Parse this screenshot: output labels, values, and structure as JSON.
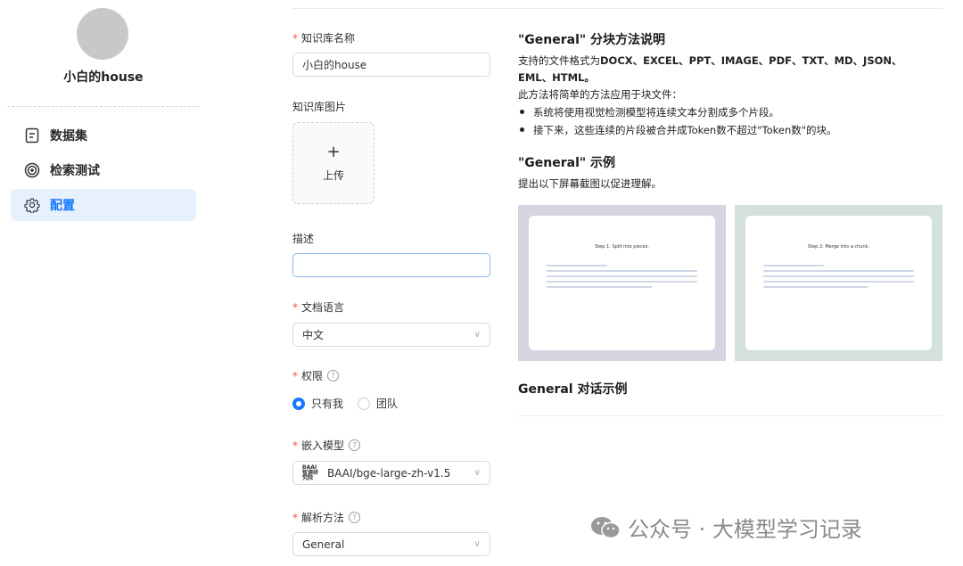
{
  "sidebar": {
    "kb_name": "小白的house",
    "items": [
      {
        "label": "数据集",
        "icon": "document-icon",
        "active": false
      },
      {
        "label": "检索测试",
        "icon": "target-icon",
        "active": false
      },
      {
        "label": "配置",
        "icon": "gear-icon",
        "active": true
      }
    ]
  },
  "form": {
    "name_label": "知识库名称",
    "name_value": "小白的house",
    "image_label": "知识库图片",
    "upload_plus": "+",
    "upload_label": "上传",
    "desc_label": "描述",
    "desc_value": "",
    "lang_label": "文档语言",
    "lang_value": "中文",
    "perm_label": "权限",
    "perm_options": [
      {
        "label": "只有我",
        "selected": true
      },
      {
        "label": "团队",
        "selected": false
      }
    ],
    "embed_label": "嵌入模型",
    "embed_logo_text": "BAAI 智源研究院",
    "embed_value": "BAAI/bge-large-zh-v1.5",
    "parse_label": "解析方法",
    "parse_value": "General",
    "help_glyph": "?",
    "required_mark": "*",
    "chevron": "∨"
  },
  "right": {
    "title1": "\"General\" 分块方法说明",
    "formats_prefix": "支持的文件格式为",
    "formats_line1": "DOCX、EXCEL、PPT、IMAGE、PDF、TXT、MD、JSON、",
    "formats_line2": "EML、HTML。",
    "method_desc": "此方法将简单的方法应用于块文件：",
    "bullets": [
      "系统将使用视觉检测模型将连续文本分割成多个片段。",
      "接下来，这些连续的片段被合并成Token数不超过\"Token数\"的块。"
    ],
    "title2": "\"General\" 示例",
    "example_desc": "提出以下屏幕截图以促进理解。",
    "images": [
      {
        "step": "Step 1: Split into pieces.",
        "bg": "#d7d4e2"
      },
      {
        "step": "Step 2: Merge into a chunk.",
        "bg": "#d4e0da"
      }
    ],
    "title3": "General 对话示例"
  },
  "watermark": {
    "text": "公众号 · 大模型学习记录",
    "icon": "wechat-icon"
  },
  "colors": {
    "accent": "#1677ff",
    "active_bg": "#e6f1fd",
    "required": "#ff4d4f"
  }
}
